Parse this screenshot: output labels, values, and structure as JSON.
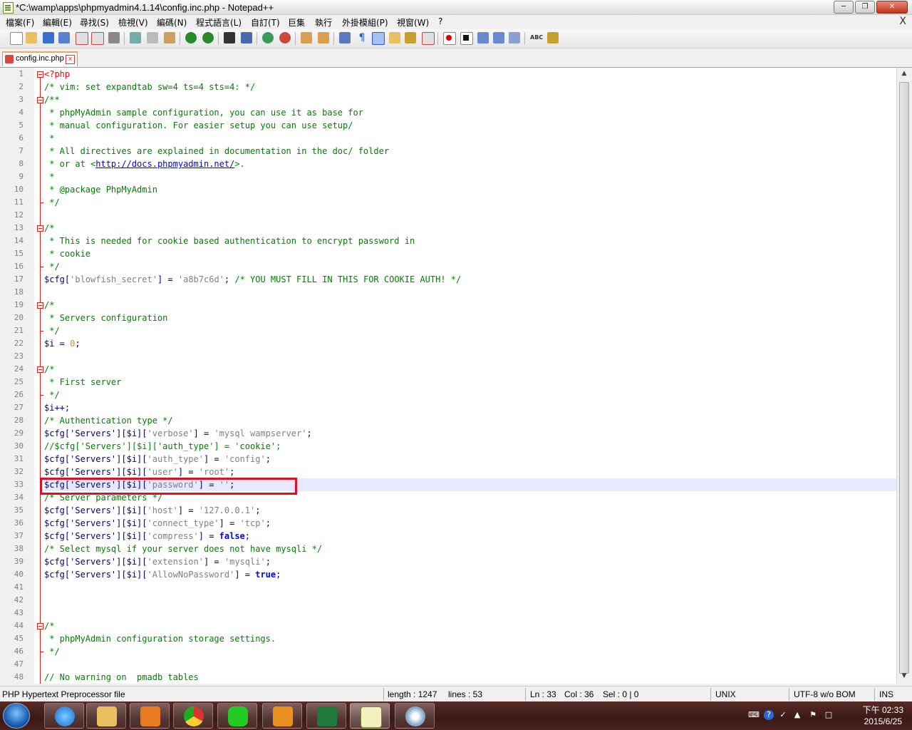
{
  "window": {
    "title": "*C:\\wamp\\apps\\phpmyadmin4.1.14\\config.inc.php - Notepad++",
    "close_label": "X"
  },
  "menu": [
    {
      "label": "檔案(F)"
    },
    {
      "label": "編輯(E)"
    },
    {
      "label": "尋找(S)"
    },
    {
      "label": "檢視(V)"
    },
    {
      "label": "編碼(N)"
    },
    {
      "label": "程式語言(L)"
    },
    {
      "label": "自訂(T)"
    },
    {
      "label": "巨集"
    },
    {
      "label": "執行"
    },
    {
      "label": "外掛模組(P)"
    },
    {
      "label": "視窗(W)"
    },
    {
      "label": "?"
    }
  ],
  "tab": {
    "label": "config.inc.php",
    "close": "x"
  },
  "editor": {
    "lines": [
      {
        "n": "1"
      },
      {
        "n": "2"
      },
      {
        "n": "3"
      },
      {
        "n": "4"
      },
      {
        "n": "5"
      },
      {
        "n": "6"
      },
      {
        "n": "7"
      },
      {
        "n": "8"
      },
      {
        "n": "9"
      },
      {
        "n": "10"
      },
      {
        "n": "11"
      },
      {
        "n": "12"
      },
      {
        "n": "13"
      },
      {
        "n": "14"
      },
      {
        "n": "15"
      },
      {
        "n": "16"
      },
      {
        "n": "17"
      },
      {
        "n": "18"
      },
      {
        "n": "19"
      },
      {
        "n": "20"
      },
      {
        "n": "21"
      },
      {
        "n": "22"
      },
      {
        "n": "23"
      },
      {
        "n": "24"
      },
      {
        "n": "25"
      },
      {
        "n": "26"
      },
      {
        "n": "27"
      },
      {
        "n": "28"
      },
      {
        "n": "29"
      },
      {
        "n": "30"
      },
      {
        "n": "31"
      },
      {
        "n": "32"
      },
      {
        "n": "33"
      },
      {
        "n": "34"
      },
      {
        "n": "35"
      },
      {
        "n": "36"
      },
      {
        "n": "37"
      },
      {
        "n": "38"
      },
      {
        "n": "39"
      },
      {
        "n": "40"
      },
      {
        "n": "41"
      },
      {
        "n": "42"
      },
      {
        "n": "43"
      },
      {
        "n": "44"
      },
      {
        "n": "45"
      },
      {
        "n": "46"
      },
      {
        "n": "47"
      },
      {
        "n": "48"
      }
    ],
    "code": {
      "l1": "<?php",
      "l2": "/* vim: set expandtab sw=4 ts=4 sts=4: */",
      "l3": "/**",
      "l4": " * phpMyAdmin sample configuration, you can use it as base for",
      "l5": " * manual configuration. For easier setup you can use setup/",
      "l6": " *",
      "l7": " * All directives are explained in documentation in the doc/ folder",
      "l8a": " * or at <",
      "l8b": "http://docs.phpmyadmin.net/",
      "l8c": ">.",
      "l9": " *",
      "l10": " * @package PhpMyAdmin",
      "l11": " */",
      "l13": "/*",
      "l14": " * This is needed for cookie based authentication to encrypt password in",
      "l15": " * cookie",
      "l16": " */",
      "l17a": "$cfg",
      "l17b": "[",
      "l17c": "'blowfish_secret'",
      "l17d": "] = ",
      "l17e": "'a8b7c6d'",
      "l17f": "; ",
      "l17g": "/* YOU MUST FILL IN THIS FOR COOKIE AUTH! */",
      "l19": "/*",
      "l20": " * Servers configuration",
      "l21": " */",
      "l22a": "$i",
      "l22b": " = ",
      "l22c": "0",
      "l22d": ";",
      "l24": "/*",
      "l25": " * First server",
      "l26": " */",
      "l27": "$i++;",
      "l28": "/* Authentication type */",
      "l29a": "$cfg['Servers'][$i][",
      "l29b": "'verbose'",
      "l29c": "] = ",
      "l29d": "'mysql wampserver'",
      "l29e": ";",
      "l30": "//$cfg['Servers'][$i]['auth_type'] = 'cookie';",
      "l31a": "$cfg['Servers'][$i][",
      "l31b": "'auth_type'",
      "l31c": "] = ",
      "l31d": "'config'",
      "l31e": ";",
      "l32a": "$cfg['Servers'][$i][",
      "l32b": "'user'",
      "l32c": "] = ",
      "l32d": "'root'",
      "l32e": ";",
      "l33a": "$cfg['Servers'][$i][",
      "l33b": "'password'",
      "l33c": "] = ",
      "l33d": "''",
      "l33e": ";",
      "l34": "/* Server parameters */",
      "l35a": "$cfg['Servers'][$i][",
      "l35b": "'host'",
      "l35c": "] = ",
      "l35d": "'127.0.0.1'",
      "l35e": ";",
      "l36a": "$cfg['Servers'][$i][",
      "l36b": "'connect_type'",
      "l36c": "] = ",
      "l36d": "'tcp'",
      "l36e": ";",
      "l37a": "$cfg['Servers'][$i][",
      "l37b": "'compress'",
      "l37c": "] = ",
      "l37d": "false",
      "l37e": ";",
      "l38": "/* Select mysql if your server does not have mysqli */",
      "l39a": "$cfg['Servers'][$i][",
      "l39b": "'extension'",
      "l39c": "] = ",
      "l39d": "'mysqli'",
      "l39e": ";",
      "l40a": "$cfg['Servers'][$i][",
      "l40b": "'AllowNoPassword'",
      "l40c": "] = ",
      "l40d": "true",
      "l40e": ";",
      "l44": "/*",
      "l45": " * phpMyAdmin configuration storage settings.",
      "l46": " */",
      "l48": "// No warning on  pmadb tables"
    }
  },
  "status": {
    "file_type": "PHP Hypertext Preprocessor file",
    "length": "length : 1247",
    "lines": "lines : 53",
    "ln": "Ln : 33",
    "col": "Col : 36",
    "sel": "Sel : 0 | 0",
    "eol": "UNIX",
    "encoding": "UTF-8 w/o BOM",
    "mode": "INS"
  },
  "taskbar": {
    "clock_period_time": "下午 02:33",
    "clock_date": "2015/6/25"
  },
  "colors": {
    "comment": "#008000",
    "string": "#808080",
    "keyword": "#0000ff",
    "variable": "#000080",
    "highlight_box": "#e01020",
    "current_line": "#e8e8ff"
  }
}
